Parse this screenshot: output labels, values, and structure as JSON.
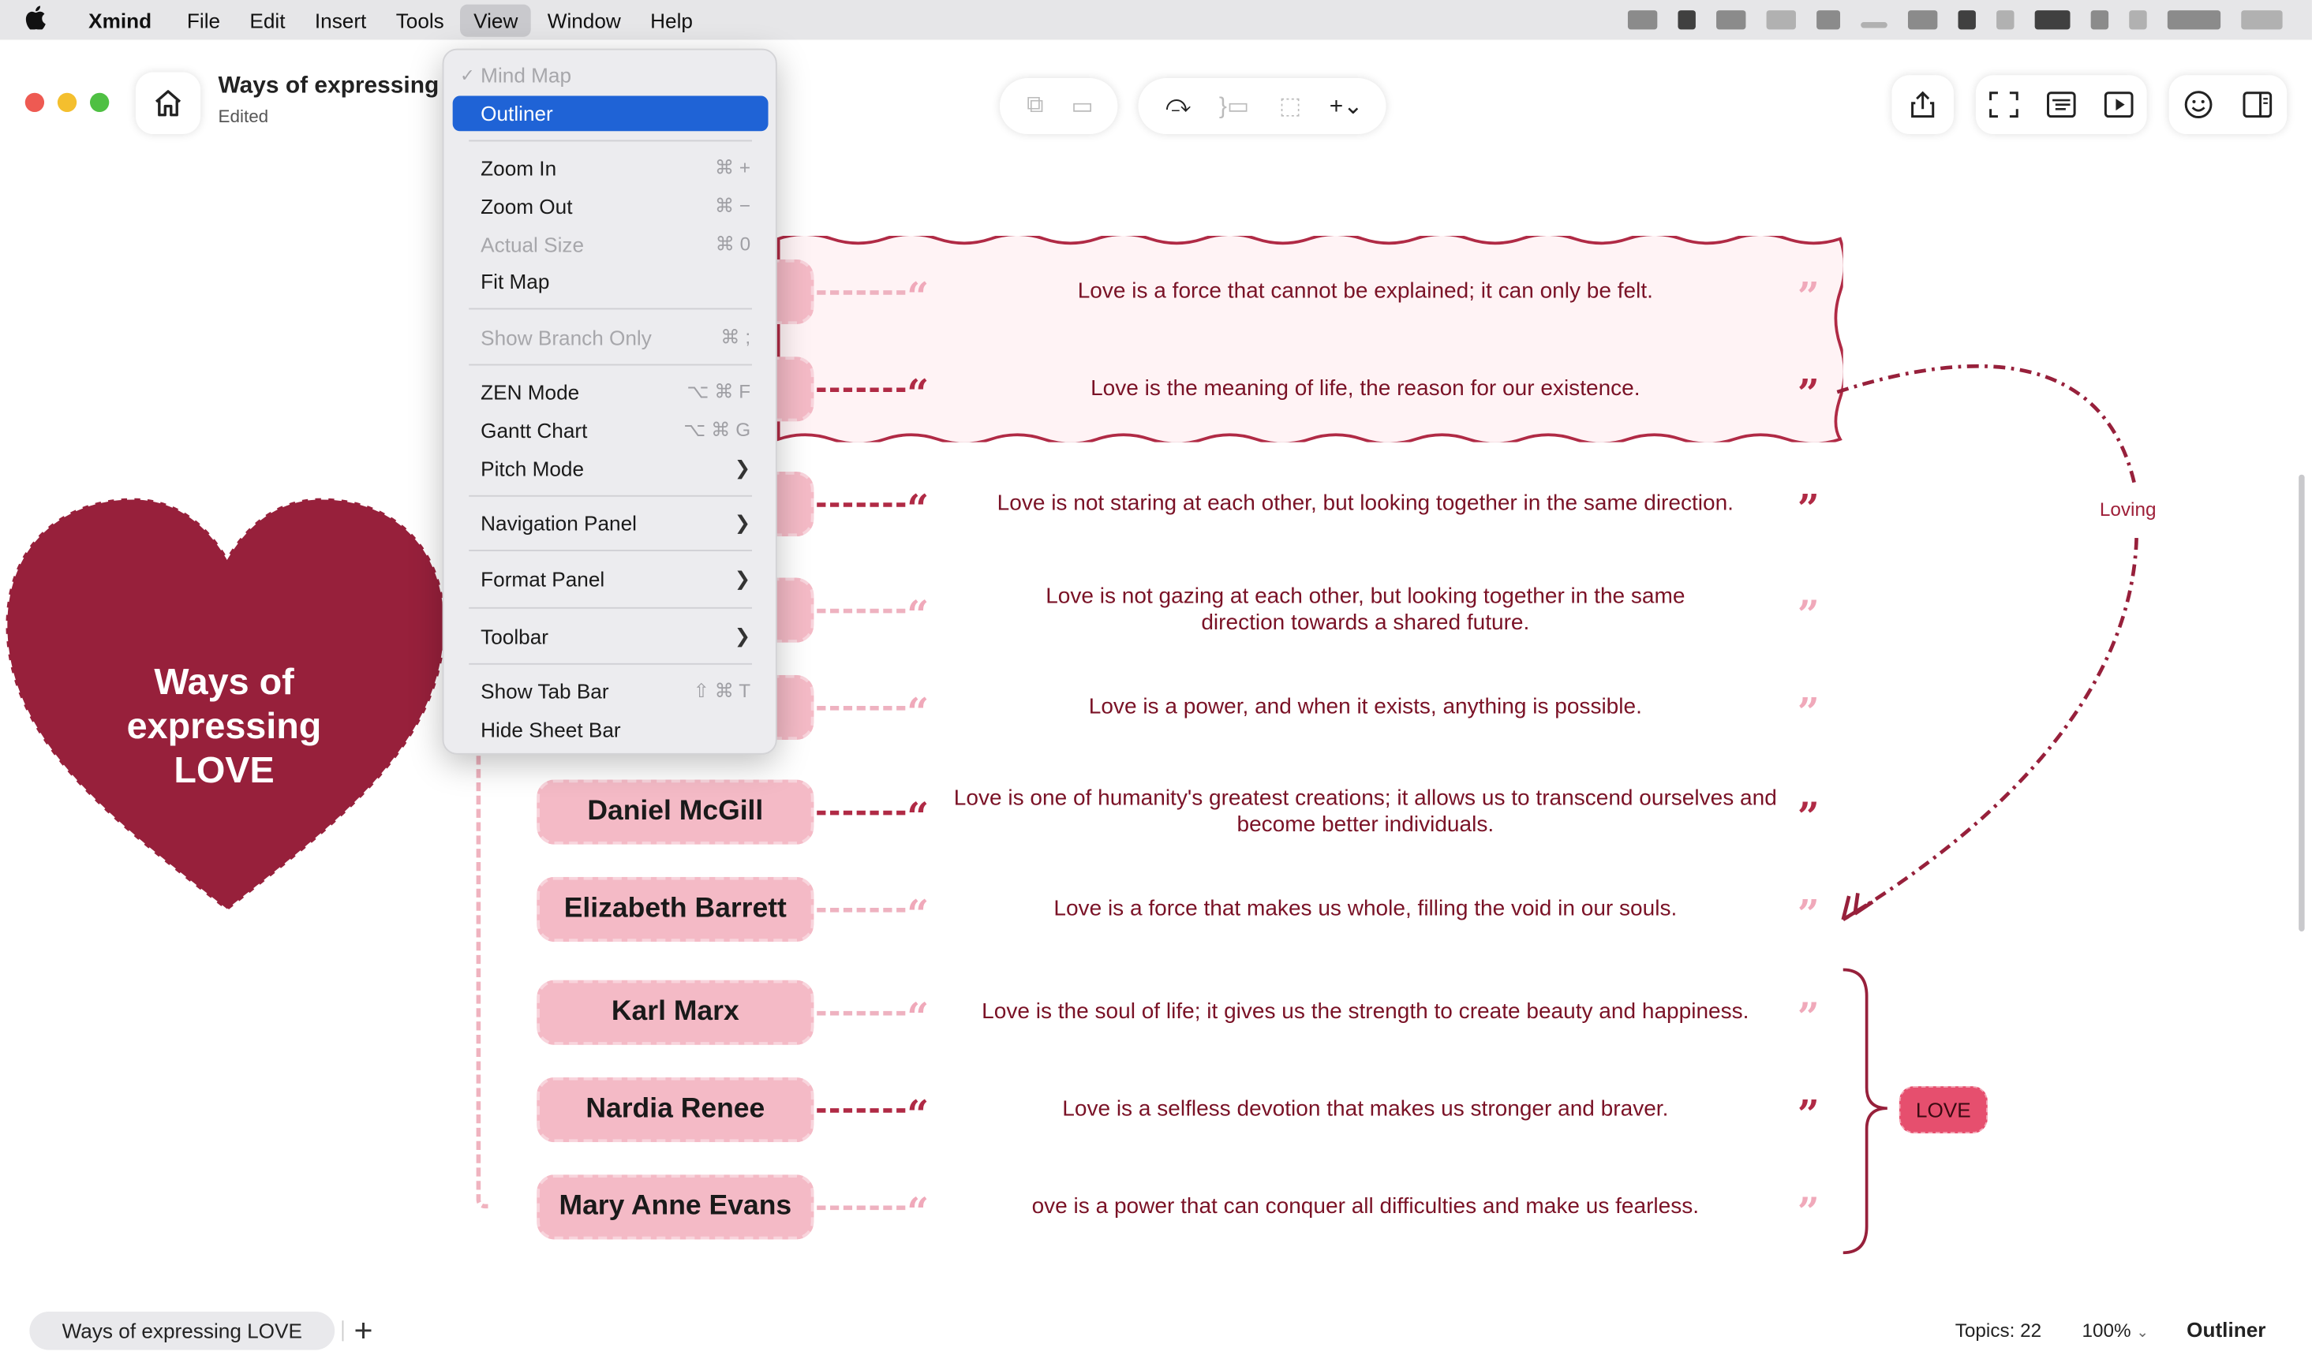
{
  "menubar": {
    "apple": "",
    "app": "Xmind",
    "items": [
      "File",
      "Edit",
      "Insert",
      "Tools",
      "View",
      "Window",
      "Help"
    ],
    "active": "View"
  },
  "window": {
    "doc_title": "Ways of expressing LOVE",
    "doc_status": "Edited"
  },
  "view_menu": {
    "items": [
      {
        "label": "Mind Map",
        "state": "checked-disabled"
      },
      {
        "label": "Outliner",
        "state": "selected"
      },
      {
        "label": "Zoom In",
        "shortcut": "⌘ +"
      },
      {
        "label": "Zoom Out",
        "shortcut": "⌘ −"
      },
      {
        "label": "Actual Size",
        "shortcut": "⌘ 0",
        "state": "disabled"
      },
      {
        "label": "Fit Map"
      },
      {
        "label": "Show Branch Only",
        "shortcut": "⌘ ;",
        "state": "disabled"
      },
      {
        "label": "ZEN Mode",
        "shortcut": "⌥ ⌘ F"
      },
      {
        "label": "Gantt Chart",
        "shortcut": "⌥ ⌘ G"
      },
      {
        "label": "Pitch Mode",
        "submenu": true
      },
      {
        "label": "Navigation Panel",
        "submenu": true
      },
      {
        "label": "Format Panel",
        "submenu": true
      },
      {
        "label": "Toolbar",
        "submenu": true
      },
      {
        "label": "Show Tab Bar",
        "shortcut": "⇧ ⌘ T"
      },
      {
        "label": "Hide Sheet Bar"
      }
    ]
  },
  "map": {
    "central_topic": [
      "Ways of",
      "expressing",
      "LOVE"
    ],
    "rows": [
      {
        "name": "",
        "quote": "Love is a force that cannot be explained; it can only be felt.",
        "soft": true
      },
      {
        "name": "",
        "quote": "Love is the meaning of life, the reason for our existence.",
        "soft": false
      },
      {
        "name": "",
        "quote": "Love is not staring at each other, but looking together in the same direction.",
        "soft": false
      },
      {
        "name": "",
        "quote": "Love is not gazing at each other, but looking together in the same direction towards a shared future.",
        "soft": true
      },
      {
        "name": "",
        "quote": "Love is a power, and when it exists, anything is possible.",
        "soft": true
      },
      {
        "name": "Daniel McGill",
        "quote": "Love is one of humanity's greatest creations; it allows us to transcend ourselves and become better individuals.",
        "soft": false
      },
      {
        "name": "Elizabeth Barrett",
        "quote": "Love is a force that makes us whole, filling the void in our souls.",
        "soft": true
      },
      {
        "name": "Karl Marx",
        "quote": "Love is the soul of life; it gives us the strength to create beauty and happiness.",
        "soft": true
      },
      {
        "name": "Nardia Renee",
        "quote": "Love is a selfless devotion that makes us stronger and braver.",
        "soft": false
      },
      {
        "name": "Mary Anne Evans",
        "quote": "ove is a power that can conquer all difficulties and make us fearless.",
        "soft": true
      }
    ],
    "relationship_label": "Loving",
    "summary_label": "LOVE",
    "quote_open": "“",
    "quote_close": "”"
  },
  "bottom": {
    "sheet_tab": "Ways of expressing LOVE",
    "add_sheet": "+",
    "topics": "Topics: 22",
    "zoom": "100%",
    "mode": "Outliner"
  },
  "colors": {
    "heart": "#97203b",
    "pill": "#f4bac6",
    "accent": "#b02a45",
    "menu_selected": "#1f63d6"
  },
  "icons": {
    "home": "home-icon",
    "share": "share-icon",
    "fullscreen": "fullscreen-icon",
    "outline": "outline-view-icon",
    "pitch": "pitch-play-icon",
    "emoji": "emoji-icon",
    "panel": "format-panel-icon"
  }
}
